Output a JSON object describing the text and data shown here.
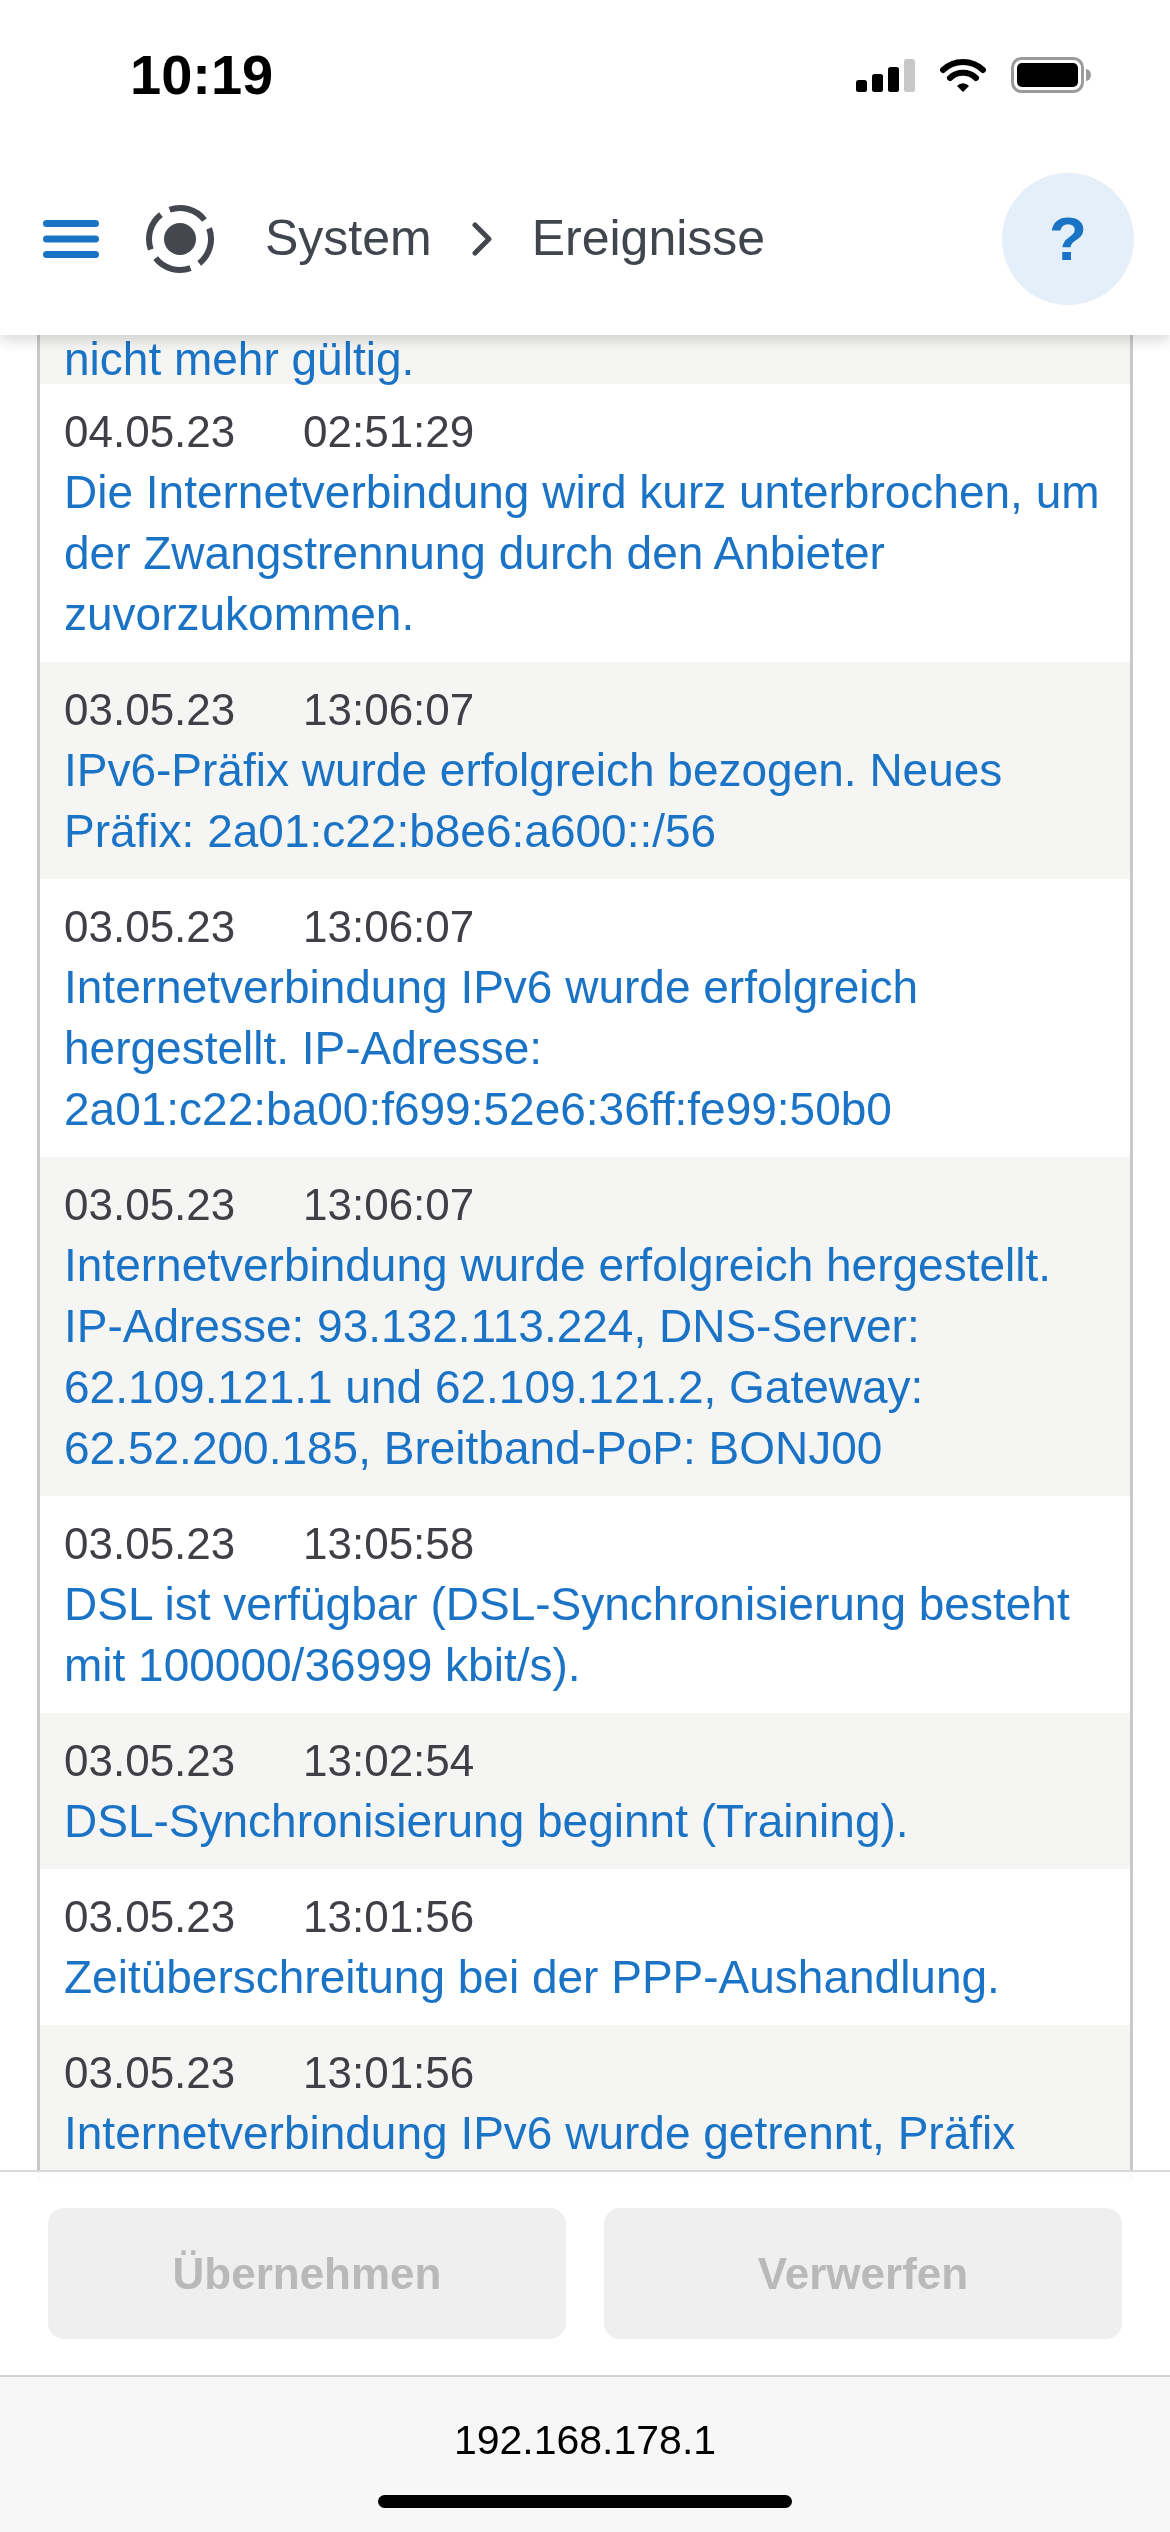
{
  "status_bar": {
    "time": "10:19"
  },
  "header": {
    "breadcrumb": [
      "System",
      "Ereignisse"
    ],
    "help": {
      "label": "?"
    }
  },
  "events": [
    {
      "message": "nicht mehr gültig."
    },
    {
      "date": "04.05.23",
      "time": "02:51:29",
      "message": "Die Internetverbindung wird kurz unterbrochen, um der Zwangstrennung durch den Anbieter zuvorzukommen."
    },
    {
      "date": "03.05.23",
      "time": "13:06:07",
      "message": "IPv6-Präfix wurde erfolgreich bezogen. Neues Präfix: 2a01:c22:b8e6:a600::/56"
    },
    {
      "date": "03.05.23",
      "time": "13:06:07",
      "message": "Internetverbindung IPv6 wurde erfolgreich hergestellt. IP-Adresse: 2a01:c22:ba00:f699:52e6:36ff:fe99:50b0"
    },
    {
      "date": "03.05.23",
      "time": "13:06:07",
      "message": "Internetverbindung wurde erfolgreich hergestellt. IP-Adresse: 93.132.113.224, DNS-Server: 62.109.121.1 und 62.109.121.2, Gateway: 62.52.200.185, Breitband-PoP: BONJ00"
    },
    {
      "date": "03.05.23",
      "time": "13:05:58",
      "message": "DSL ist verfügbar (DSL-Synchronisierung besteht mit 100000/36999 kbit/s)."
    },
    {
      "date": "03.05.23",
      "time": "13:02:54",
      "message": "DSL-Synchronisierung beginnt (Training)."
    },
    {
      "date": "03.05.23",
      "time": "13:01:56",
      "message": "Zeitüberschreitung bei der PPP-Aushandlung."
    },
    {
      "date": "03.05.23",
      "time": "13:01:56",
      "message": "Internetverbindung IPv6 wurde getrennt, Präfix"
    }
  ],
  "actions": [
    {
      "label": "Übernehmen",
      "disabled": true
    },
    {
      "label": "Verwerfen",
      "disabled": true
    }
  ],
  "browser_bar": {
    "url": "192.168.178.1"
  }
}
